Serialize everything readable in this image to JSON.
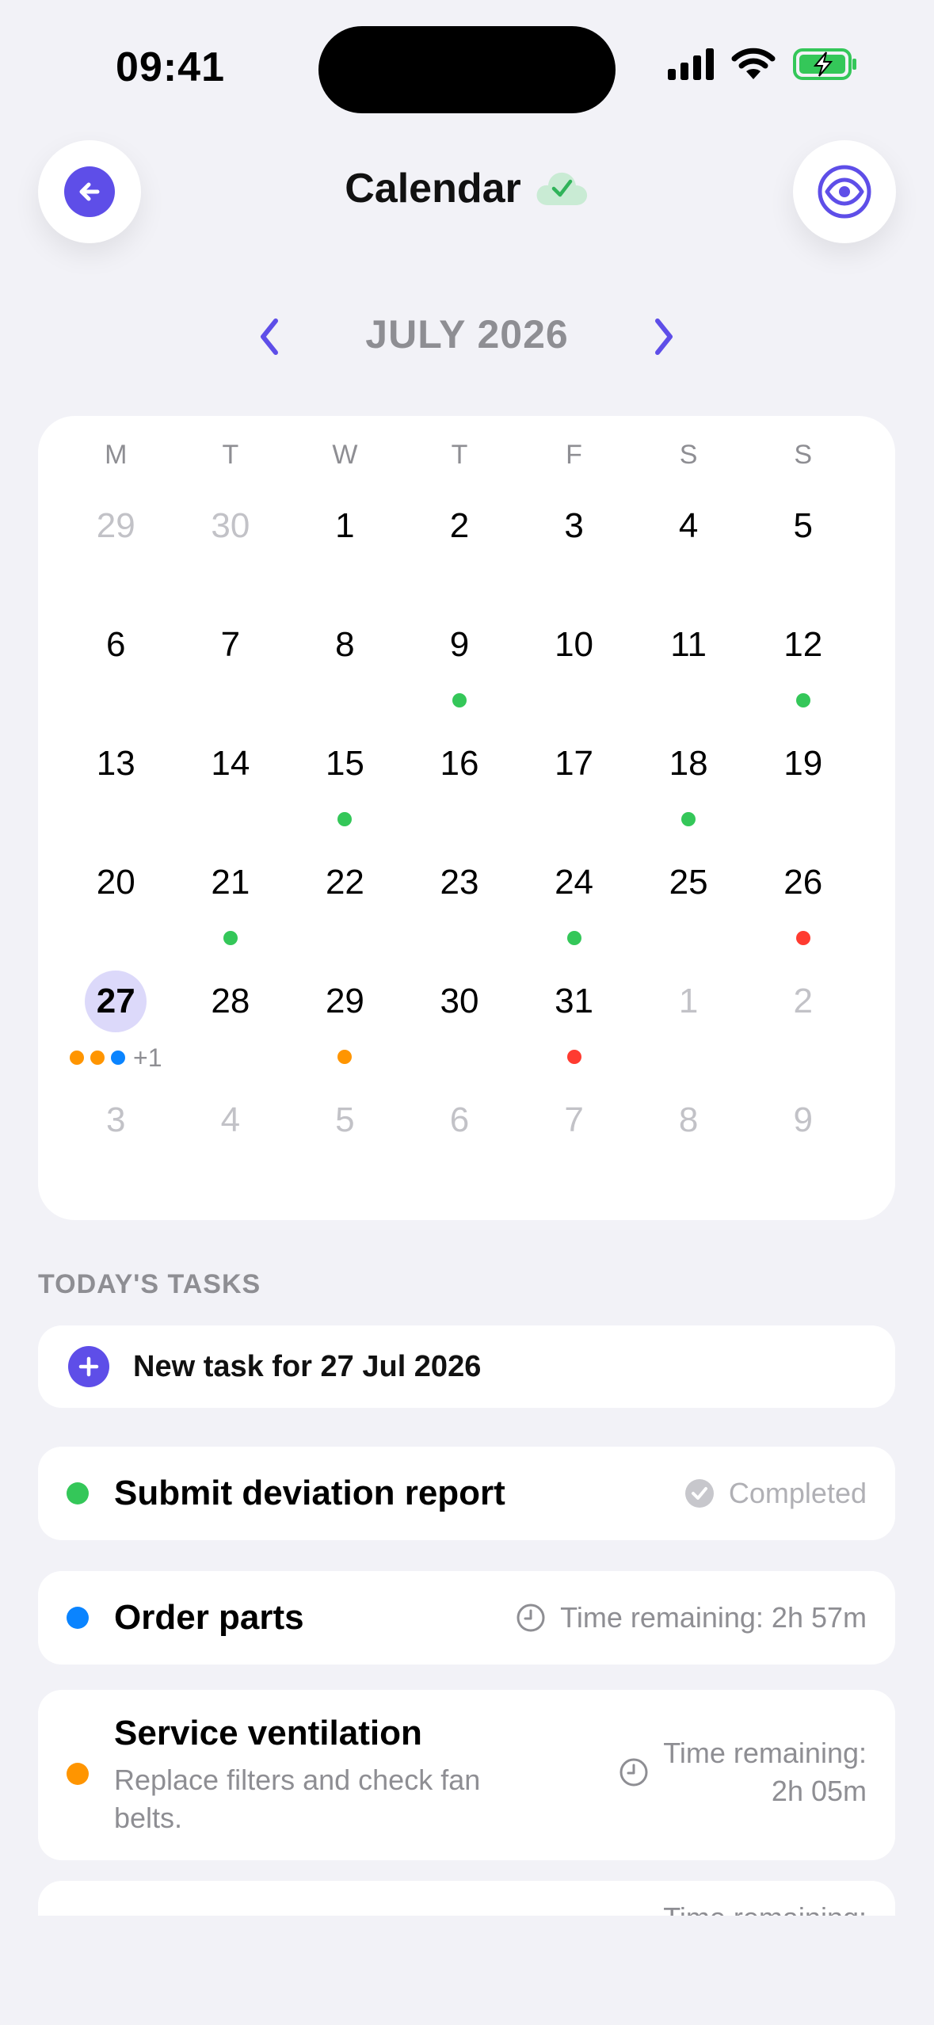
{
  "status_bar": {
    "time": "09:41"
  },
  "header": {
    "title": "Calendar",
    "sync_icon": "cloud-check-icon",
    "back_icon": "arrow-left-icon",
    "view_icon": "eye-icon",
    "accent": "#5e4ee8"
  },
  "calendar": {
    "month_label": "JULY 2026",
    "weekdays": [
      "M",
      "T",
      "W",
      "T",
      "F",
      "S",
      "S"
    ],
    "days": [
      {
        "n": "29",
        "muted": true,
        "dots": []
      },
      {
        "n": "30",
        "muted": true,
        "dots": []
      },
      {
        "n": "1",
        "dots": []
      },
      {
        "n": "2",
        "dots": []
      },
      {
        "n": "3",
        "dots": []
      },
      {
        "n": "4",
        "dots": []
      },
      {
        "n": "5",
        "dots": []
      },
      {
        "n": "6",
        "dots": []
      },
      {
        "n": "7",
        "dots": []
      },
      {
        "n": "8",
        "dots": []
      },
      {
        "n": "9",
        "dots": [
          "#34c759"
        ]
      },
      {
        "n": "10",
        "dots": []
      },
      {
        "n": "11",
        "dots": []
      },
      {
        "n": "12",
        "dots": [
          "#34c759"
        ]
      },
      {
        "n": "13",
        "dots": []
      },
      {
        "n": "14",
        "dots": []
      },
      {
        "n": "15",
        "dots": [
          "#34c759"
        ]
      },
      {
        "n": "16",
        "dots": []
      },
      {
        "n": "17",
        "dots": []
      },
      {
        "n": "18",
        "dots": [
          "#34c759"
        ]
      },
      {
        "n": "19",
        "dots": []
      },
      {
        "n": "20",
        "dots": []
      },
      {
        "n": "21",
        "dots": [
          "#34c759"
        ]
      },
      {
        "n": "22",
        "dots": []
      },
      {
        "n": "23",
        "dots": []
      },
      {
        "n": "24",
        "dots": [
          "#34c759"
        ]
      },
      {
        "n": "25",
        "dots": []
      },
      {
        "n": "26",
        "dots": [
          "#ff3b30"
        ]
      },
      {
        "n": "27",
        "today": true,
        "dots": [
          "#ff9500",
          "#ff9500",
          "#0a84ff"
        ],
        "more": "+1"
      },
      {
        "n": "28",
        "dots": []
      },
      {
        "n": "29",
        "dots": [
          "#ff9500"
        ]
      },
      {
        "n": "30",
        "dots": []
      },
      {
        "n": "31",
        "dots": [
          "#ff3b30"
        ]
      },
      {
        "n": "1",
        "muted": true,
        "dots": []
      },
      {
        "n": "2",
        "muted": true,
        "dots": []
      },
      {
        "n": "3",
        "muted": true,
        "dots": []
      },
      {
        "n": "4",
        "muted": true,
        "dots": []
      },
      {
        "n": "5",
        "muted": true,
        "dots": []
      },
      {
        "n": "6",
        "muted": true,
        "dots": []
      },
      {
        "n": "7",
        "muted": true,
        "dots": []
      },
      {
        "n": "8",
        "muted": true,
        "dots": []
      },
      {
        "n": "9",
        "muted": true,
        "dots": []
      }
    ]
  },
  "tasks": {
    "section_title": "TODAY'S TASKS",
    "new_task_label": "New task for 27 Jul 2026",
    "items": [
      {
        "title": "Submit deviation report",
        "color": "#34c759",
        "status": "Completed",
        "status_icon": "check-circle-icon"
      },
      {
        "title": "Order parts",
        "color": "#0a84ff",
        "status": "Time remaining: 2h 57m",
        "status_icon": "clock-icon"
      },
      {
        "title": "Service ventilation",
        "color": "#ff9500",
        "description": "Replace filters and check fan belts.",
        "status_line1": "Time remaining:",
        "status_line2": "2h 05m",
        "status_icon": "clock-icon"
      },
      {
        "status_partial": "Time remaining:"
      }
    ]
  }
}
